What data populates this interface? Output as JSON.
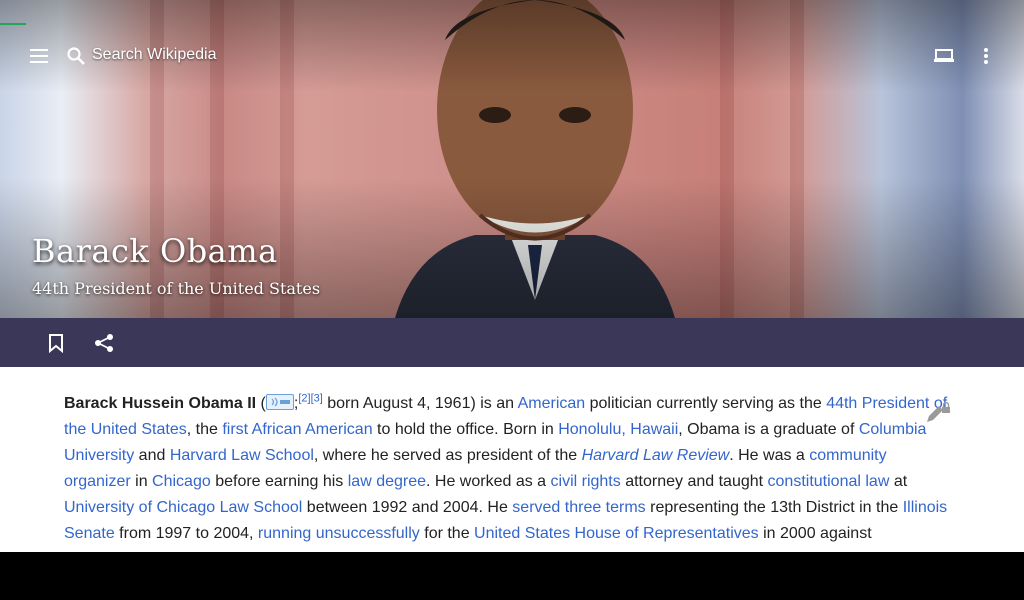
{
  "toolbar": {
    "search_placeholder": "Search Wikipedia",
    "menu_icon": "hamburger-menu-icon",
    "search_icon": "search-icon",
    "tabs_icon": "tabs-icon",
    "overflow_icon": "more-vert-icon"
  },
  "article": {
    "title": "Barack Obama",
    "subtitle": "44th President of the United States"
  },
  "action_bar": {
    "bookmark_icon": "bookmark-icon",
    "share_icon": "share-icon",
    "color": "#3b3758"
  },
  "lead": {
    "s1": "Barack Hussein Obama II",
    "s2": " (",
    "s3": ";",
    "ref1": "[2]",
    "ref2": "[3]",
    "s4": " born August 4, 1961) is an ",
    "l_american": "American",
    "s5": " politician currently serving as the ",
    "l_44th": "44th President of the United States",
    "s6": ", the ",
    "l_first": "first African American",
    "s7": " to hold the office. Born in ",
    "l_honolulu": "Honolulu, Hawaii",
    "s8": ", Obama is a graduate of ",
    "l_columbia": "Columbia University",
    "s9": " and ",
    "l_harvard": "Harvard Law School",
    "s10": ", where he served as president of the ",
    "l_review": "Harvard Law Review",
    "s11": ". He was a ",
    "l_organizer": "community organizer",
    "s12": " in ",
    "l_chicago": "Chicago",
    "s13": " before earning his ",
    "l_lawdegree": "law degree",
    "s14": ". He worked as a ",
    "l_civil": "civil rights",
    "s15": " attorney and taught ",
    "l_constitutional": "constitutional law",
    "s16": " at ",
    "l_uchicago": "University of Chicago Law School",
    "s17": " between 1992 and 2004. He ",
    "l_terms": "served three terms",
    "s18": " representing the 13th District in the ",
    "l_senate": "Illinois Senate",
    "s19": " from 1997 to 2004, ",
    "l_running": "running unsuccessfully",
    "s20": " for the ",
    "l_house": "United States House of Representatives",
    "s21": " in 2000 against"
  },
  "colors": {
    "link": "#3366cc",
    "progress": "#23a55a"
  }
}
